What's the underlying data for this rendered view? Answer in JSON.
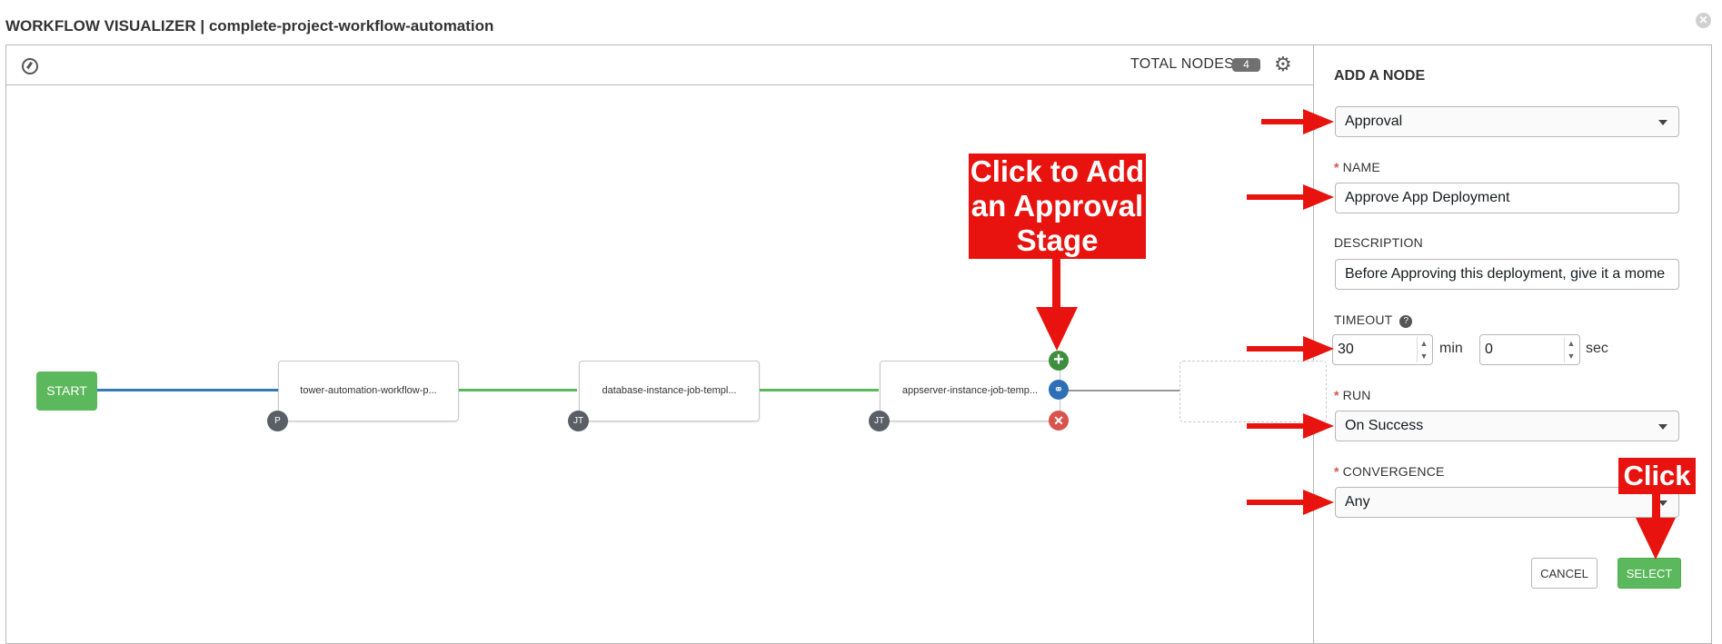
{
  "window": {
    "title": "WORKFLOW VISUALIZER | complete-project-workflow-automation",
    "close_icon": "close-icon"
  },
  "toolbar": {
    "total_nodes_label": "TOTAL NODES",
    "total_nodes_count": "4",
    "compass_icon": "compass-icon",
    "settings_icon": "gear-icon"
  },
  "graph": {
    "start_label": "START",
    "nodes": [
      {
        "label": "tower-automation-workflow-p...",
        "type_badge": "P"
      },
      {
        "label": "database-instance-job-templ...",
        "type_badge": "JT"
      },
      {
        "label": "appserver-instance-job-temp...",
        "type_badge": "JT"
      }
    ],
    "node_actions": {
      "add": "add-icon",
      "link": "link-icon",
      "delete": "delete-icon"
    },
    "edge_colors": {
      "always": "#337ab7",
      "success": "#5cb85c",
      "pending": "#999999"
    }
  },
  "annotations": {
    "add_approval_callout": [
      "Click to Add",
      "an Approval",
      "Stage"
    ],
    "select_callout": "Click",
    "color": "#e8130f"
  },
  "panel": {
    "title": "ADD A NODE",
    "node_type_value": "Approval",
    "name_label": "NAME",
    "name_value": "Approve App Deployment",
    "description_label": "DESCRIPTION",
    "description_value": "Before Approving this deployment, give it a mome",
    "timeout_label": "TIMEOUT",
    "timeout_min_value": "30",
    "timeout_min_unit": "min",
    "timeout_sec_value": "0",
    "timeout_sec_unit": "sec",
    "run_label": "RUN",
    "run_value": "On Success",
    "convergence_label": "CONVERGENCE",
    "convergence_value": "Any",
    "required_marker": "*",
    "cancel_label": "CANCEL",
    "select_label": "SELECT",
    "accent_color": "#5cb85c"
  }
}
